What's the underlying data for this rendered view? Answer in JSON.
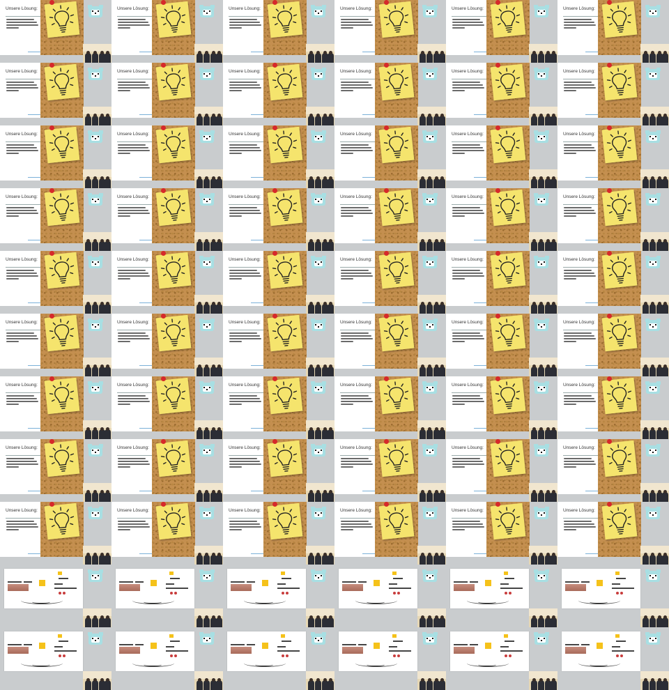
{
  "slides": {
    "title": "Unsere Lösung:"
  },
  "colors": {
    "background": "#c9ccce",
    "note": "#f5e46d",
    "cork": "#c48f4f",
    "pin": "#d6292a",
    "bear": "#a8dfe3"
  },
  "icons": {
    "lightbulb": "lightbulb-icon",
    "pin": "pushpin-icon",
    "bear": "bear-mascot-icon",
    "webcam": "webcam-thumbnail"
  }
}
